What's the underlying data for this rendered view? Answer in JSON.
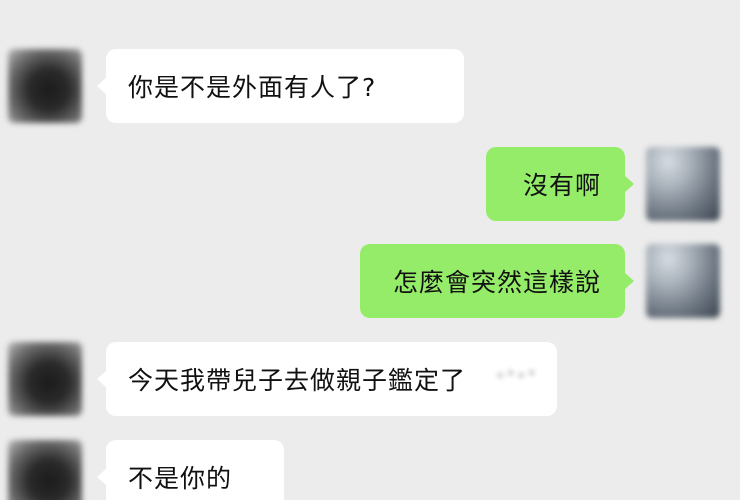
{
  "chat": {
    "messages": [
      {
        "sender": "other",
        "text": "你是不是外面有人了?"
      },
      {
        "sender": "me",
        "text": "沒有啊"
      },
      {
        "sender": "me",
        "text": "怎麼會突然這樣說"
      },
      {
        "sender": "other",
        "text": "今天我帶兒子去做親子鑑定了"
      },
      {
        "sender": "other",
        "text": "不是你的"
      }
    ]
  },
  "colors": {
    "background": "#ececec",
    "incoming_bubble": "#ffffff",
    "outgoing_bubble": "#95ec69"
  }
}
